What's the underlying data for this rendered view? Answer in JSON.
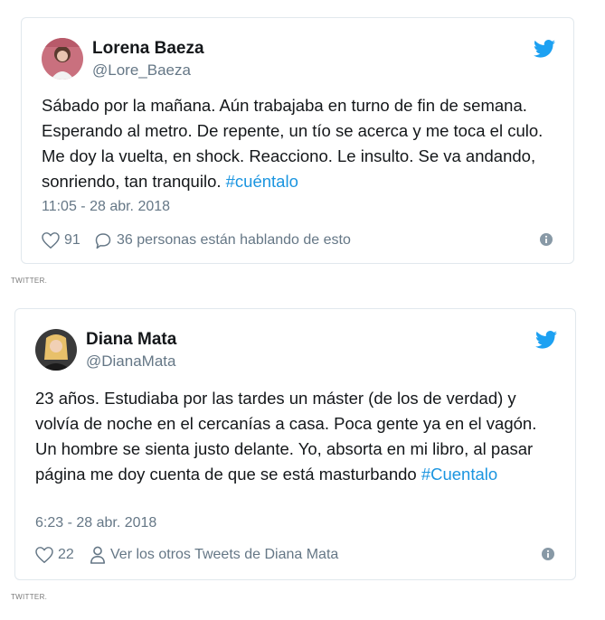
{
  "tweets": [
    {
      "name": "Lorena Baeza",
      "handle": "@Lore_Baeza",
      "body_text": "Sábado por la mañana. Aún trabajaba en turno de fin de semana. Esperando al metro. De repente, un tío se acerca y me toca el culo. Me doy la vuelta, en shock. Reacciono. Le insulto. Se va andando, sonriendo, tan tranquilo.",
      "hashtag": "#cuéntalo",
      "timestamp": "11:05 - 28 abr. 2018",
      "likes": "91",
      "secondary_label": "36 personas están hablando de esto",
      "secondary_icon": "comment-icon"
    },
    {
      "name": "Diana Mata",
      "handle": "@DianaMata",
      "body_text": "23 años. Estudiaba por las tardes un máster (de los de verdad) y volvía de noche en el cercanías a casa. Poca gente ya en el vagón. Un hombre se sienta justo delante. Yo, absorta en mi libro, al pasar página me doy cuenta de que se está masturbando",
      "hashtag": "#Cuentalo",
      "timestamp": "6:23 - 28 abr. 2018",
      "likes": "22",
      "secondary_label": "Ver los otros Tweets de Diana Mata",
      "secondary_icon": "person-icon"
    }
  ],
  "captions": [
    "TWITTER.",
    "TWITTER."
  ],
  "colors": {
    "twitter_blue": "#1da1f2",
    "hashtag": "#1b95e0",
    "secondary_text": "#657786",
    "border": "#e1e8ed"
  }
}
